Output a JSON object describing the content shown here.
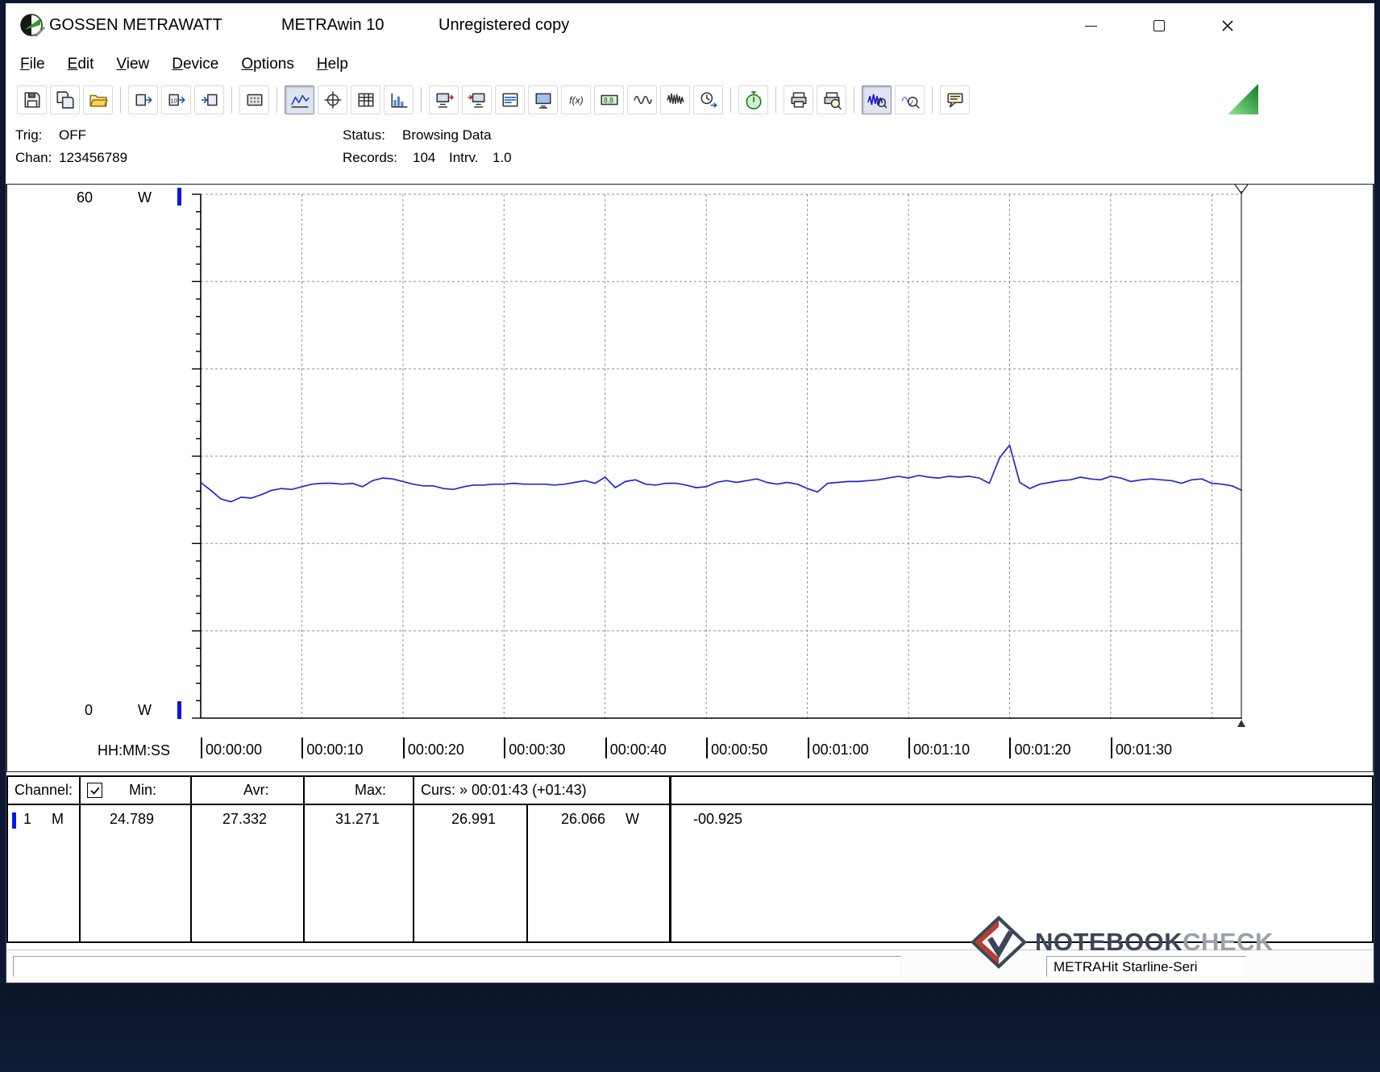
{
  "window": {
    "brand": "GOSSEN METRAWATT",
    "app": "METRAwin 10",
    "license": "Unregistered copy",
    "titlebar_icons": [
      "app-logo-icon",
      "minimize-icon",
      "maximize-icon",
      "close-icon"
    ]
  },
  "menu": [
    "File",
    "Edit",
    "View",
    "Device",
    "Options",
    "Help"
  ],
  "toolbar": {
    "groups": [
      [
        "save-icon",
        "save-all-icon",
        "open-folder-icon"
      ],
      [
        "export-data-icon",
        "export-10x-icon",
        "import-data-icon"
      ],
      [
        "keypad-icon"
      ],
      [
        "line-chart-icon",
        "crosshair-icon",
        "data-table-icon",
        "histogram-icon"
      ],
      [
        "monitor-out-icon",
        "monitor-in-icon",
        "channel-list-icon",
        "monitor-icon",
        "function-icon",
        "seven-segment-icon",
        "waveform-icon",
        "noise-icon",
        "clock-transfer-icon"
      ],
      [
        "stopwatch-icon"
      ],
      [
        "print-icon",
        "print-preview-icon"
      ],
      [
        "zoom-wave-icon",
        "zoom-out-icon"
      ],
      [
        "callout-icon"
      ]
    ],
    "pressed": [
      "line-chart-icon",
      "zoom-wave-icon"
    ],
    "corner_icon": "green-triangle-icon"
  },
  "status_panel": {
    "trig_label": "Trig:",
    "trig_value": "OFF",
    "chan_label": "Chan:",
    "chan_value": "123456789",
    "status_label": "Status:",
    "status_value": "Browsing Data",
    "records_label": "Records:",
    "records_value": "104",
    "interval_label": "Intrv.",
    "interval_value": "1.0"
  },
  "chart_data": {
    "type": "line",
    "title": "",
    "xlabel": "HH:MM:SS",
    "ylabel": "W",
    "y_max_label": "60",
    "y_min_label": "0",
    "y_unit": "W",
    "ylim": [
      0,
      60
    ],
    "grid": "dashed",
    "legend": "none",
    "x_range_seconds": [
      0,
      103
    ],
    "grid_step_seconds": 10,
    "x_tick_seconds": [
      0,
      10,
      20,
      30,
      40,
      50,
      60,
      70,
      80,
      90
    ],
    "x_tick_labels": [
      "00:00:00",
      "00:00:10",
      "00:00:20",
      "00:00:30",
      "00:00:40",
      "00:00:50",
      "00:01:00",
      "00:01:10",
      "00:01:20",
      "00:01:30"
    ],
    "series": [
      {
        "name": "Channel 1 power (W)",
        "color": "#2626d2",
        "x_start": 0,
        "x_step": 1,
        "values": [
          27.0,
          26.1,
          25.1,
          24.789,
          25.3,
          25.2,
          25.6,
          26.1,
          26.3,
          26.2,
          26.5,
          26.8,
          26.9,
          26.9,
          26.8,
          26.9,
          26.5,
          27.2,
          27.5,
          27.4,
          27.1,
          26.8,
          26.6,
          26.6,
          26.3,
          26.2,
          26.5,
          26.7,
          26.7,
          26.8,
          26.8,
          26.9,
          26.8,
          26.8,
          26.8,
          26.7,
          26.8,
          27.0,
          27.2,
          26.9,
          27.6,
          26.4,
          27.1,
          27.3,
          26.8,
          26.7,
          26.9,
          26.9,
          26.7,
          26.4,
          26.5,
          27.0,
          27.2,
          27.0,
          27.2,
          27.4,
          27.0,
          26.8,
          27.0,
          26.8,
          26.3,
          25.9,
          26.9,
          27.0,
          27.1,
          27.1,
          27.2,
          27.3,
          27.5,
          27.7,
          27.5,
          27.8,
          27.6,
          27.5,
          27.7,
          27.6,
          27.7,
          27.5,
          26.9,
          29.8,
          31.271,
          27.0,
          26.3,
          26.8,
          27.0,
          27.2,
          27.3,
          27.6,
          27.4,
          27.3,
          27.7,
          27.5,
          27.1,
          27.3,
          27.4,
          27.3,
          27.2,
          26.9,
          27.3,
          27.4,
          26.9,
          26.8,
          26.6,
          26.066
        ]
      }
    ],
    "cursor": {
      "position": "right-edge",
      "time": "00:01:43"
    }
  },
  "table": {
    "header": {
      "channel": "Channel:",
      "min": "Min:",
      "avr": "Avr:",
      "max": "Max:",
      "curs": "Curs: » 00:01:43 (+01:43)"
    },
    "row": {
      "channel": "1",
      "mode": "M",
      "visible": true,
      "min": "24.789",
      "avr": "27.332",
      "max": "31.271",
      "curs_a": "26.991",
      "curs_b": "26.066",
      "curs_unit": "W",
      "delta": "-00.925"
    }
  },
  "statusbar": {
    "device": "METRAHit Starline-Seri"
  },
  "watermark": {
    "brand_dark": "NOTEBOOK",
    "brand_light": "CHECK",
    "icon": "notebookcheck-check-icon"
  },
  "colors": {
    "series": "#2626d2",
    "channel_marker": "#0018e8",
    "grid": "#8f8f8f",
    "triangle_green": "#1f9a2f"
  }
}
